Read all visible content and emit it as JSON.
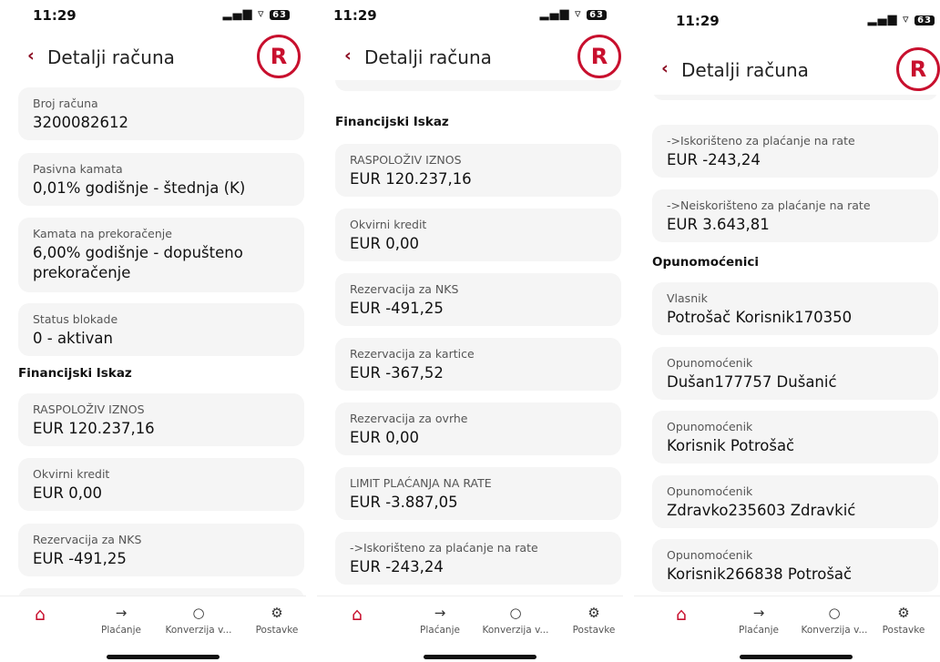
{
  "status": {
    "time": "11:29",
    "signal": "▂▄▆",
    "wifi": "▿",
    "battery": "63"
  },
  "header": {
    "back_icon": "‹",
    "title": "Detalji računa",
    "logo_letter": "R"
  },
  "fields": {
    "broj_racuna": {
      "label": "Broj računa",
      "value": "3200082612"
    },
    "pasivna_kamata": {
      "label": "Pasivna kamata",
      "value": "0,01% godišnje - štednja (K)"
    },
    "kamata_prekoracenje": {
      "label": "Kamata na prekoračenje",
      "value": "6,00% godišnje - dopušteno prekoračenje"
    },
    "status_blokade": {
      "label": "Status blokade",
      "value": "0 - aktivan"
    },
    "raspolozivo": {
      "label": "RASPOLOŽIV IZNOS",
      "value": "EUR 120.237,16"
    },
    "okvirni_kredit": {
      "label": "Okvirni kredit",
      "value": "EUR 0,00"
    },
    "rez_nks": {
      "label": "Rezervacija za NKS",
      "value": "EUR -491,25"
    },
    "rez_kartice": {
      "label": "Rezervacija za kartice",
      "value": "EUR -367,52"
    },
    "rez_ovrhe": {
      "label": "Rezervacija za ovrhe",
      "value": "EUR 0,00"
    },
    "limit_rate": {
      "label": "LIMIT PLAĆANJA NA RATE",
      "value": "EUR -3.887,05"
    },
    "iskoristeno": {
      "label": "->Iskorišteno za plaćanje na rate",
      "value": "EUR -243,24"
    },
    "neiskoristeno": {
      "label": "->Neiskorišteno za plaćanje na rate",
      "value": "EUR 3.643,81"
    },
    "vlasnik": {
      "label": "Vlasnik",
      "value": "Potrošač Korisnik170350"
    },
    "opun1": {
      "label": "Opunomoćenik",
      "value": "Dušan177757 Dušanić"
    },
    "opun2": {
      "label": "Opunomoćenik",
      "value": "Korisnik Potrošač"
    },
    "opun3": {
      "label": "Opunomoćenik",
      "value": "Zdravko235603 Zdravkić"
    },
    "opun4": {
      "label": "Opunomoćenik",
      "value": "Korisnik266838 Potrošač"
    }
  },
  "sections": {
    "financijski": "Financijski Iskaz",
    "opunomocenici": "Opunomoćenici"
  },
  "tabs": [
    {
      "icon": "⌂",
      "label": ""
    },
    {
      "icon": "→",
      "label": "Plaćanje"
    },
    {
      "icon": "○",
      "label": "Konverzija v..."
    },
    {
      "icon": "⚙",
      "label": "Postavke"
    }
  ],
  "colors": {
    "accent": "#c8102e",
    "back": "#8b0d22",
    "card": "#f5f5f5"
  }
}
